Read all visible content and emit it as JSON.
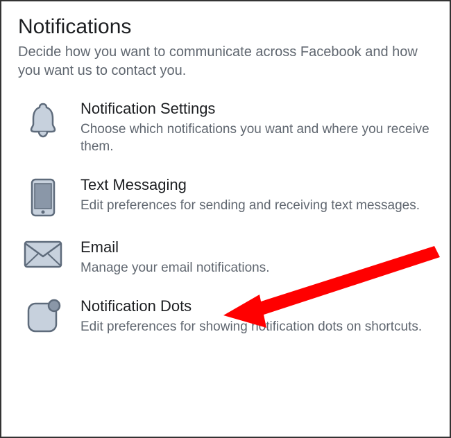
{
  "header": {
    "title": "Notifications",
    "subtitle": "Decide how you want to communicate across Facebook and how you want us to contact you."
  },
  "items": [
    {
      "title": "Notification Settings",
      "desc": "Choose which notifications you want and where you receive them."
    },
    {
      "title": "Text Messaging",
      "desc": "Edit preferences for sending and receiving text messages."
    },
    {
      "title": "Email",
      "desc": "Manage your email notifications."
    },
    {
      "title": "Notification Dots",
      "desc": "Edit preferences for showing notification dots on shortcuts."
    }
  ],
  "colors": {
    "icon_fill": "#c7d1dd",
    "icon_stroke": "#5e6b7b",
    "arrow": "#ff0000"
  }
}
